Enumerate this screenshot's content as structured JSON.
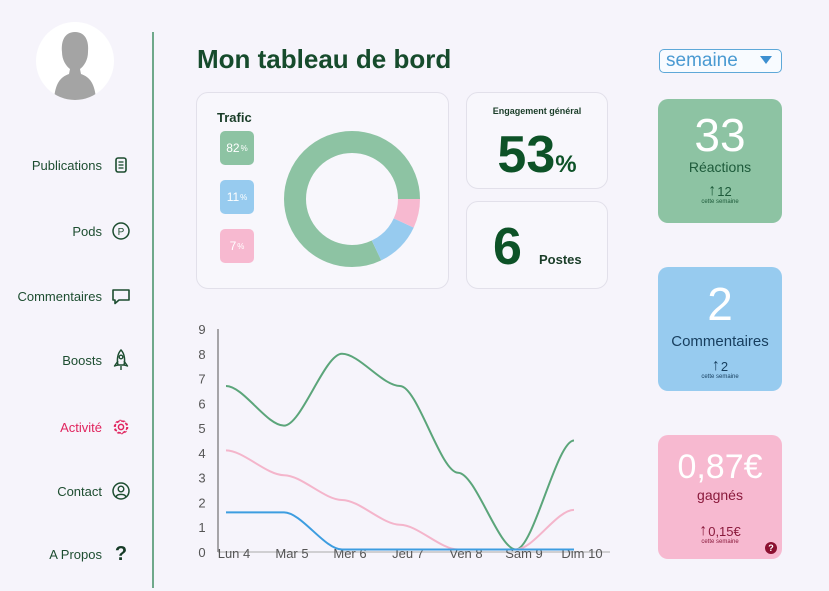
{
  "page": {
    "title": "Mon tableau de bord"
  },
  "period_select": {
    "value": "semaine"
  },
  "sidebar": {
    "items": [
      {
        "label": "Publications",
        "icon": "document-icon"
      },
      {
        "label": "Pods",
        "icon": "p-circle-icon"
      },
      {
        "label": "Commentaires",
        "icon": "comment-icon"
      },
      {
        "label": "Boosts",
        "icon": "rocket-icon"
      },
      {
        "label": "Activité",
        "icon": "gear-icon",
        "active": true
      },
      {
        "label": "Contact",
        "icon": "user-circle-icon"
      },
      {
        "label": "A Propos",
        "icon": "question-icon"
      }
    ]
  },
  "traffic": {
    "title": "Trafic",
    "slices": [
      {
        "label": "82",
        "unit": "%",
        "value": 82,
        "color": "#8dc3a3"
      },
      {
        "label": "11",
        "unit": "%",
        "value": 11,
        "color": "#97cbef"
      },
      {
        "label": "7",
        "unit": "%",
        "value": 7,
        "color": "#f7b9d0"
      }
    ]
  },
  "engagement": {
    "title": "Engagement général",
    "value": "53",
    "unit": "%"
  },
  "posts": {
    "value": "6",
    "label": "Postes"
  },
  "tiles": [
    {
      "value": "33",
      "label": "Réactions",
      "change": "12",
      "sub": "cette semaine",
      "color": "#8dc3a3",
      "text_color": "#1d5a3a"
    },
    {
      "value": "2",
      "label": "Commentaires",
      "change": "2",
      "sub": "cette semaine",
      "color": "#97cbef",
      "text_color": "#173e5e"
    },
    {
      "value": "0,87€",
      "label": "gagnés",
      "change": "0,15€",
      "sub": "cette semaine",
      "color": "#f7b9d0",
      "text_color": "#8a1a3c"
    }
  ],
  "chart_data": {
    "type": "line",
    "categories": [
      "Lun 4",
      "Mar 5",
      "Mer 6",
      "Jeu 7",
      "Ven 8",
      "Sam 9",
      "Dim 10"
    ],
    "ylim": [
      0,
      9
    ],
    "yticks": [
      "0",
      "1",
      "2",
      "3",
      "4",
      "5",
      "6",
      "7",
      "8",
      "9"
    ],
    "grid": false,
    "series": [
      {
        "values": [
          6.7,
          5.1,
          8.0,
          6.7,
          3.2,
          0.1,
          4.5
        ],
        "color": "#5ba57a"
      },
      {
        "values": [
          4.1,
          3.1,
          2.1,
          1.1,
          0.1,
          0.1,
          1.7
        ],
        "color": "#f4b5cb"
      },
      {
        "values": [
          1.6,
          1.6,
          0.1,
          0.1,
          0.1,
          0.1,
          0.1
        ],
        "color": "#3d9de0"
      }
    ]
  }
}
